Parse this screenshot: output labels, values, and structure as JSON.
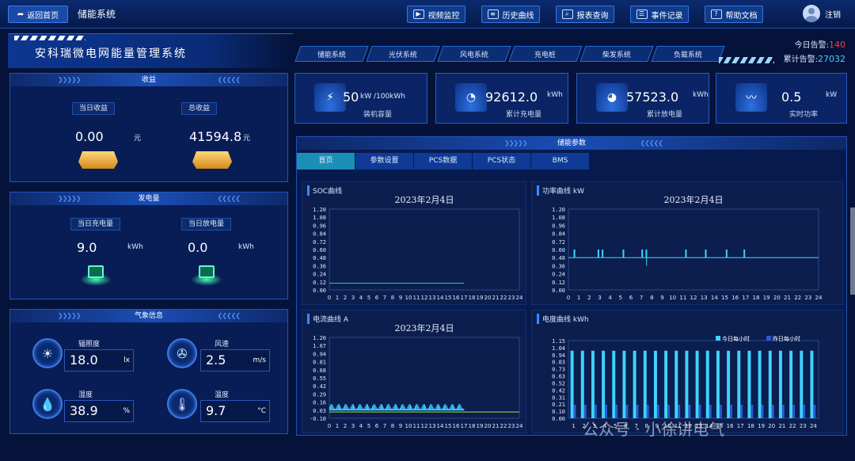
{
  "topbar": {
    "back_label": "返回首页",
    "system_title": "储能系统",
    "buttons": [
      {
        "label": "视频监控",
        "icon": "video-icon"
      },
      {
        "label": "历史曲线",
        "icon": "chart-icon"
      },
      {
        "label": "报表查询",
        "icon": "search-icon"
      },
      {
        "label": "事件记录",
        "icon": "document-icon"
      },
      {
        "label": "帮助文档",
        "icon": "help-icon"
      }
    ],
    "logout_label": "注销"
  },
  "header": {
    "title": "安科瑞微电网能量管理系统"
  },
  "nav_tabs": [
    "储能系统",
    "光伏系统",
    "风电系统",
    "充电桩",
    "柴发系统",
    "负载系统"
  ],
  "alarm": {
    "today_label": "今日告警:",
    "today_value": "140",
    "total_label": "累计告警:",
    "total_value": "27032",
    "today_color": "#ff3b3b",
    "total_color": "#3fd3ff"
  },
  "income": {
    "title": "收益",
    "today_label": "当日收益",
    "today_value": "0.00",
    "total_label": "总收益",
    "total_value": "41594.8",
    "unit": "元"
  },
  "generation": {
    "title": "发电量",
    "charge_label": "当日充电量",
    "charge_value": "9.0",
    "discharge_label": "当日放电量",
    "discharge_value": "0.0",
    "unit": "kWh"
  },
  "weather": {
    "title": "气象信息",
    "items": [
      {
        "label": "辐照度",
        "value": "18.0",
        "unit": "lx",
        "icon": "sun-icon"
      },
      {
        "label": "风速",
        "value": "2.5",
        "unit": "m/s",
        "icon": "fan-icon"
      },
      {
        "label": "湿度",
        "value": "38.9",
        "unit": "%",
        "icon": "humidity-icon"
      },
      {
        "label": "温度",
        "value": "9.7",
        "unit": "°C",
        "icon": "thermometer-icon"
      }
    ]
  },
  "cards": [
    {
      "value": "50",
      "unit": "kW /100kWh",
      "caption": "装机容量",
      "icon": "battery-icon"
    },
    {
      "value": "92612.0",
      "unit": "kWh",
      "caption": "累计充电量",
      "icon": "gauge-icon"
    },
    {
      "value": "57523.0",
      "unit": "kWh",
      "caption": "累计放电量",
      "icon": "gauge-icon"
    },
    {
      "value": "0.5",
      "unit": "kW",
      "caption": "实时功率",
      "icon": "pulse-icon"
    }
  ],
  "storage": {
    "title": "储能参数",
    "subtabs": [
      "首页",
      "参数设置",
      "PCS数据",
      "PCS状态",
      "BMS"
    ],
    "active_tab": "首页"
  },
  "watermark": "公众号 · 小徐讲电气",
  "chart_data": [
    {
      "type": "line",
      "panel_title": "SOC曲线",
      "title": "2023年2月4日",
      "x_ticks": [
        "0",
        "1",
        "2",
        "3",
        "4",
        "5",
        "6",
        "7",
        "8",
        "9",
        "10",
        "11",
        "12",
        "13",
        "14",
        "15",
        "16",
        "17",
        "18",
        "19",
        "20",
        "21",
        "22",
        "23",
        "24"
      ],
      "y_ticks": [
        "1.20",
        "1.08",
        "0.96",
        "0.84",
        "0.72",
        "0.60",
        "0.48",
        "0.36",
        "0.24",
        "0.12",
        "0.00"
      ],
      "ylim": [
        0,
        1.2
      ],
      "series": [
        {
          "color": "#3bd16f",
          "x": [
            0,
            17
          ],
          "y": [
            0.1,
            0.1
          ]
        }
      ]
    },
    {
      "type": "line",
      "panel_title": "功率曲线 kW",
      "title": "2023年2月4日",
      "x_ticks": [
        "0",
        "1",
        "2",
        "3",
        "4",
        "5",
        "6",
        "7",
        "8",
        "9",
        "10",
        "11",
        "12",
        "13",
        "14",
        "15",
        "16",
        "17",
        "18",
        "19",
        "20",
        "21",
        "22",
        "23",
        "24"
      ],
      "y_ticks": [
        "1.20",
        "1.08",
        "0.96",
        "0.84",
        "0.72",
        "0.60",
        "0.48",
        "0.36",
        "0.24",
        "0.12",
        "0.00"
      ],
      "ylim": [
        0,
        1.2
      ],
      "series": [
        {
          "color": "#3fd3ff",
          "x": [
            0,
            24
          ],
          "y": [
            0.48,
            0.48
          ]
        }
      ],
      "spikes": [
        0.5,
        2.8,
        3.2,
        5.2,
        7.0,
        7.4,
        11.2,
        13.1,
        15.1,
        16.8
      ],
      "dip": 7.5
    },
    {
      "type": "line",
      "panel_title": "电流曲线 A",
      "title": "2023年2月4日",
      "x_ticks": [
        "0",
        "1",
        "2",
        "3",
        "4",
        "5",
        "6",
        "7",
        "8",
        "9",
        "10",
        "11",
        "12",
        "13",
        "14",
        "15",
        "16",
        "17",
        "18",
        "19",
        "20",
        "21",
        "22",
        "23",
        "24"
      ],
      "y_ticks": [
        "1.20",
        "1.07",
        "0.94",
        "0.81",
        "0.68",
        "0.55",
        "0.42",
        "0.29",
        "0.16",
        "0.03",
        "-0.10"
      ],
      "ylim": [
        -0.1,
        1.2
      ],
      "series": [
        {
          "color": "#3fd3ff",
          "x": [
            0,
            17
          ],
          "y": [
            0.03,
            0.03
          ]
        }
      ]
    },
    {
      "type": "bar",
      "panel_title": "电度曲线 kWh",
      "title": "",
      "categories": [
        "1",
        "2",
        "3",
        "4",
        "5",
        "6",
        "7",
        "8",
        "9",
        "10",
        "11",
        "12",
        "13",
        "14",
        "15",
        "16",
        "17",
        "18",
        "19",
        "20",
        "21",
        "22",
        "23",
        "24"
      ],
      "y_ticks": [
        "1.15",
        "1.04",
        "0.94",
        "0.83",
        "0.73",
        "0.63",
        "0.52",
        "0.42",
        "0.31",
        "0.21",
        "0.10",
        "0.00"
      ],
      "ylim": [
        0,
        1.15
      ],
      "series": [
        {
          "name": "今日每小时",
          "color": "#3fd3ff",
          "values": [
            1.0,
            1.0,
            1.0,
            1.0,
            1.0,
            1.0,
            1.0,
            1.0,
            1.0,
            1.0,
            1.0,
            1.0,
            1.0,
            1.0,
            1.0,
            1.0,
            1.0,
            1.0,
            1.0,
            1.0,
            1.0,
            1.0,
            1.0,
            1.0
          ]
        },
        {
          "name": "昨日每小时",
          "color": "#2a5bd8",
          "values": [
            0.2,
            0.2,
            0.2,
            0.2,
            0.2,
            0.2,
            0.2,
            0.2,
            0.2,
            0.2,
            0.2,
            0.2,
            0.2,
            0.2,
            0.2,
            0.2,
            0.2,
            0.2,
            0.2,
            0.2,
            0.2,
            0.2,
            0.2,
            0.2
          ]
        }
      ]
    }
  ]
}
